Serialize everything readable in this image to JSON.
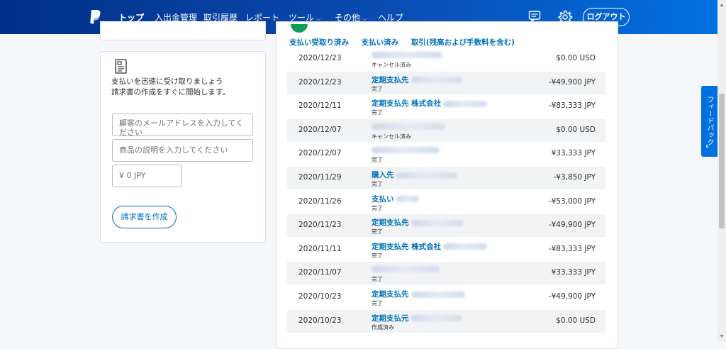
{
  "nav": {
    "items": [
      {
        "label": "トップ",
        "dropdown": false
      },
      {
        "label": "入出金管理",
        "dropdown": false
      },
      {
        "label": "取引履歴",
        "dropdown": false
      },
      {
        "label": "レポート",
        "dropdown": false
      },
      {
        "label": "ツール",
        "dropdown": true
      },
      {
        "label": "その他",
        "dropdown": true
      },
      {
        "label": "ヘルプ",
        "dropdown": false
      }
    ],
    "logout_label": "ログアウト",
    "icons": {
      "logo": "paypal-logo",
      "messages": "message-center-icon",
      "settings": "gear-icon"
    }
  },
  "invoice": {
    "icon": "invoice-document-icon",
    "line1": "支払いを迅速に受け取りましょう",
    "line2": "請求書の作成をすぐに開始します。",
    "email_placeholder": "顧客のメールアドレスを入力してください",
    "desc_placeholder": "商品の説明を入力してください",
    "amount_placeholder": "¥ 0 JPY",
    "create_button": "請求書を作成"
  },
  "activity": {
    "tabs": [
      "支払い受取り済み",
      "支払い済み",
      "取引(残高および手数料を含む)"
    ],
    "rows": [
      {
        "date": "2020/12/23",
        "name": "",
        "status": "キャンセル済み",
        "amount": "$0.00 USD"
      },
      {
        "date": "2020/12/23",
        "name": "定期支払先",
        "status": "完了",
        "amount": "-¥49,900 JPY"
      },
      {
        "date": "2020/12/11",
        "name": "定期支払先 株式会社",
        "status": "完了",
        "amount": "-¥83,333 JPY"
      },
      {
        "date": "2020/12/07",
        "name": "",
        "status": "キャンセル済み",
        "amount": "$0.00 USD"
      },
      {
        "date": "2020/12/07",
        "name": "",
        "status": "完了",
        "amount": "¥33,333 JPY"
      },
      {
        "date": "2020/11/29",
        "name": "購入先",
        "status": "完了",
        "amount": "-¥3,850 JPY"
      },
      {
        "date": "2020/11/26",
        "name": "支払い",
        "status": "完了",
        "amount": "-¥53,000 JPY"
      },
      {
        "date": "2020/11/23",
        "name": "定期支払先",
        "status": "完了",
        "amount": "-¥49,900 JPY"
      },
      {
        "date": "2020/11/11",
        "name": "定期支払先 株式会社",
        "status": "完了",
        "amount": "-¥83,333 JPY"
      },
      {
        "date": "2020/11/07",
        "name": "",
        "status": "完了",
        "amount": "¥33,333 JPY"
      },
      {
        "date": "2020/10/23",
        "name": "定期支払先",
        "status": "完了",
        "amount": "-¥49,900 JPY"
      },
      {
        "date": "2020/10/23",
        "name": "定期支払元",
        "status": "作成済み",
        "amount": "$0.00 USD"
      }
    ]
  },
  "feedback_label": "フィードバック",
  "colors": {
    "nav_start": "#003087",
    "nav_end": "#0070e0",
    "link": "#0070ba",
    "accent_green": "#0f9d58"
  }
}
